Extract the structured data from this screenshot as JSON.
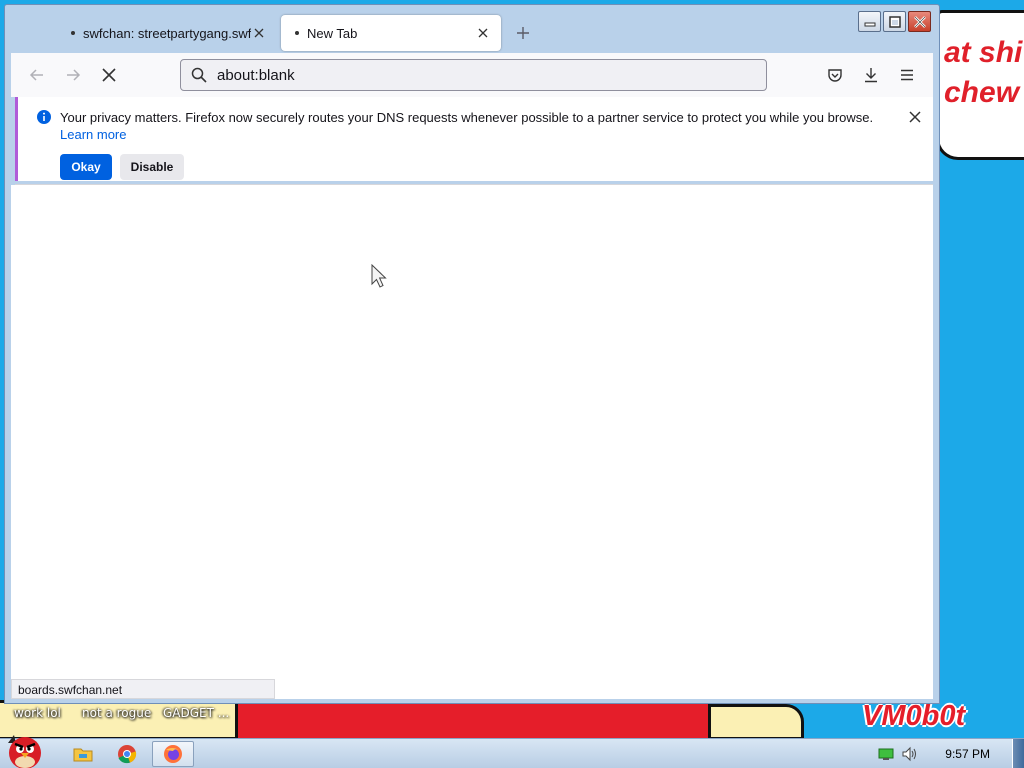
{
  "desktop": {
    "bubble_line1": "at shi",
    "bubble_line2": "chew",
    "labels": [
      "work lol",
      "not a rogue",
      "GADGET ..."
    ],
    "watermark": "VM0b0t"
  },
  "browser": {
    "tabs": [
      {
        "label": "swfchan: streetpartygang.swf",
        "active": false
      },
      {
        "label": "New Tab",
        "active": true
      }
    ],
    "address": "about:blank",
    "notification": {
      "message": "Your privacy matters. Firefox now securely routes your DNS requests whenever possible to a partner service to protect you while you browse.",
      "link": "Learn more",
      "okay_label": "Okay",
      "disable_label": "Disable"
    },
    "status_url": "boards.swfchan.net"
  },
  "taskbar": {
    "clock": "9:57 PM",
    "apps": [
      "file-explorer-icon",
      "chrome-icon",
      "firefox-icon"
    ]
  },
  "colors": {
    "accent": "#0061e0",
    "wallpaper": "#1ca9e8",
    "notification_stripe": "#b05cd8"
  }
}
